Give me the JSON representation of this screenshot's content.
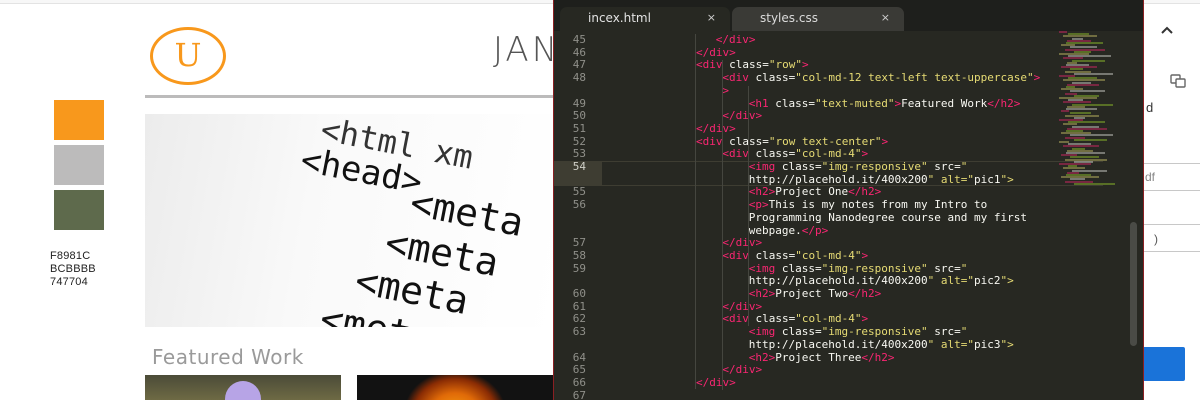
{
  "page": {
    "logo_letter": "U",
    "name": "JAN",
    "swatches": [
      {
        "color": "#F8981C"
      },
      {
        "color": "#BCBBBB"
      },
      {
        "color": "#747704"
      }
    ],
    "hex_codes": [
      "F8981C",
      "BCBBBB",
      "747704"
    ],
    "hero_lines": [
      "<html xm",
      "<head>",
      "<meta",
      "<meta",
      "<meta",
      "<meta"
    ],
    "featured_heading": "Featured Work",
    "right_panel": {
      "d_label": "d",
      "box1_text": "df",
      "box2_text": ")"
    }
  },
  "editor": {
    "tabs": [
      {
        "label": "incex.html",
        "close": "×"
      },
      {
        "label": "styles.css",
        "close": "×"
      }
    ],
    "line_numbers": [
      "45",
      "46",
      "47",
      "48",
      "49",
      "50",
      "51",
      "52",
      "53",
      "54",
      "55",
      "56",
      "57",
      "58",
      "59",
      "60",
      "61",
      "62",
      "63",
      "64",
      "65",
      "66",
      "67"
    ],
    "code_lines": [
      "</div>",
      "</div>",
      "<div class=\"row\">",
      "<div class=\"col-md-12 text-left text-uppercase\">",
      ">",
      "<h1 class=\"text-muted\">Featured Work</h2>",
      "</div>",
      "</div>",
      "<div class=\"row text-center\">",
      "<div class=\"col-md-4\">",
      "<img class=\"img-responsive\" src=\"",
      "http://placehold.it/400x200\" alt=\"pic1\">",
      "<h2>Project One</h2>",
      "<p>This is my notes from my Intro to",
      "Programming Nanodegree course and my first",
      "webpage.</p>",
      "</div>",
      "<div class=\"col-md-4\">",
      "<img class=\"img-responsive\" src=\"",
      "http://placehold.it/400x200\" alt=\"pic2\">",
      "<h2>Project Two</h2>",
      "</div>",
      "<div class=\"col-md-4\">",
      "<img class=\"img-responsive\" src=\"",
      "http://placehold.it/400x200\" alt=\"pic3\">",
      "<h2>Project Three</h2>",
      "</div>",
      "</div>"
    ]
  },
  "colors": {
    "accent": "#F8981C",
    "editor_bg": "#272822",
    "tag": "#f92672",
    "attr": "#a6e22e",
    "string": "#e6db74"
  }
}
